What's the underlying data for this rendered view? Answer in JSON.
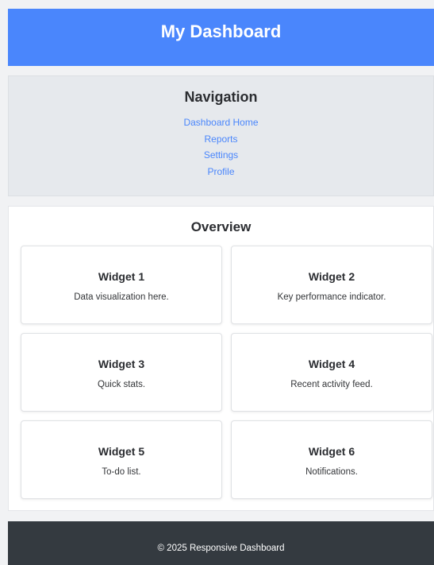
{
  "header": {
    "title": "My Dashboard"
  },
  "nav": {
    "title": "Navigation",
    "links": [
      {
        "label": "Dashboard Home"
      },
      {
        "label": "Reports"
      },
      {
        "label": "Settings"
      },
      {
        "label": "Profile"
      }
    ]
  },
  "overview": {
    "title": "Overview",
    "widgets": [
      {
        "title": "Widget 1",
        "text": "Data visualization here."
      },
      {
        "title": "Widget 2",
        "text": "Key performance indicator."
      },
      {
        "title": "Widget 3",
        "text": "Quick stats."
      },
      {
        "title": "Widget 4",
        "text": "Recent activity feed."
      },
      {
        "title": "Widget 5",
        "text": "To-do list."
      },
      {
        "title": "Widget 6",
        "text": "Notifications."
      }
    ]
  },
  "footer": {
    "text": "© 2025 Responsive Dashboard"
  },
  "colors": {
    "header_bg": "#4a86fc",
    "nav_bg": "#e6e9ed",
    "link": "#4a86fc",
    "footer_bg": "#343a40"
  }
}
